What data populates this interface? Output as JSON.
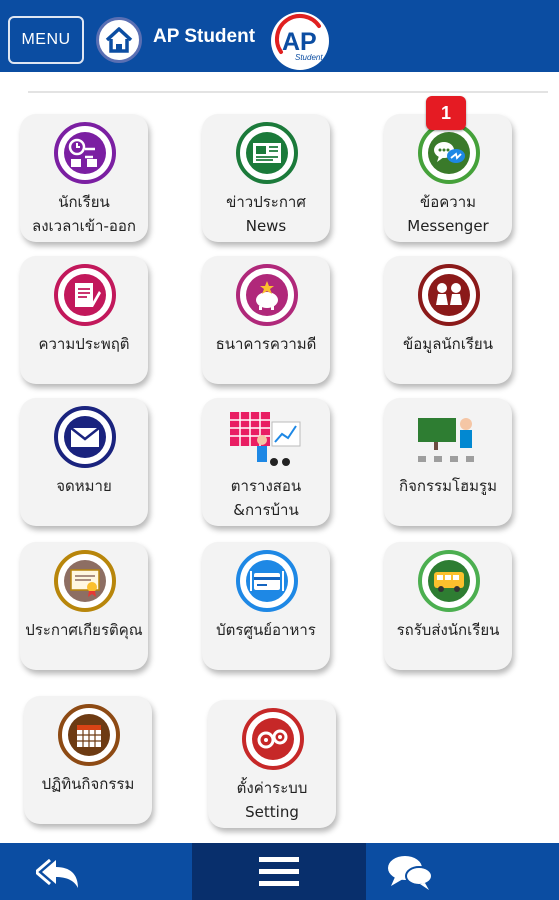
{
  "header": {
    "menu_label": "MENU",
    "title": "AP Student",
    "logo_text": "AP",
    "logo_sub": "Student"
  },
  "tiles": [
    {
      "line1": "นักเรียน",
      "line2": "ลงเวลาเข้า-ออก",
      "icon": "clock-attendance-icon",
      "ring": "#7b1fa2"
    },
    {
      "line1": "ข่าวประกาศ",
      "line2": "News",
      "icon": "newspaper-icon",
      "ring": "#1b7a3a"
    },
    {
      "line1": "ข้อความ",
      "line2": "Messenger",
      "icon": "chat-bubbles-icon",
      "ring": "#45a13a"
    },
    {
      "line1": "ความประพฤติ",
      "line2": "",
      "icon": "notebook-pen-icon",
      "ring": "#c2185b"
    },
    {
      "line1": "ธนาคารความดี",
      "line2": "",
      "icon": "piggy-bank-icon",
      "ring": "#b0287a"
    },
    {
      "line1": "ข้อมูลนักเรียน",
      "line2": "",
      "icon": "students-icon",
      "ring": "#8b1a1a"
    },
    {
      "line1": "จดหมาย",
      "line2": "",
      "icon": "envelope-icon",
      "ring": "#1a237e"
    },
    {
      "line1": "ตารางสอน",
      "line2": "&การบ้าน",
      "icon": "timetable-icon",
      "ring": "#e91e63"
    },
    {
      "line1": "กิจกรรมโฮมรูม",
      "line2": "",
      "icon": "classroom-icon",
      "ring": "#2e7d32"
    },
    {
      "line1": "ประกาศเกียรติคุณ",
      "line2": "",
      "icon": "certificate-icon",
      "ring": "#b8860b"
    },
    {
      "line1": "บัตรศูนย์อาหาร",
      "line2": "",
      "icon": "food-card-icon",
      "ring": "#1e88e5"
    },
    {
      "line1": "รถรับส่งนักเรียน",
      "line2": "",
      "icon": "school-bus-icon",
      "ring": "#4caf50"
    },
    {
      "line1": "ปฏิทินกิจกรรม",
      "line2": "",
      "icon": "calendar-icon",
      "ring": "#8d4a14"
    },
    {
      "line1": "ตั้งค่าระบบ",
      "line2": "Setting",
      "icon": "gears-icon",
      "ring": "#c62828"
    }
  ],
  "badge": {
    "count": "1"
  },
  "bottom_nav": {
    "back": "back-arrow-icon",
    "menu": "hamburger-icon",
    "chat": "chat-icon"
  }
}
